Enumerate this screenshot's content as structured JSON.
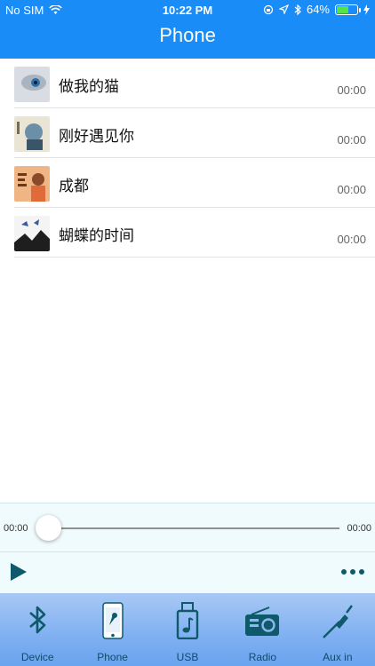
{
  "status_bar": {
    "carrier": "No SIM",
    "time": "10:22 PM",
    "battery": "64%",
    "battery_level": 0.64
  },
  "header": {
    "title": "Phone"
  },
  "songs": [
    {
      "name": "做我的猫",
      "duration": "00:00"
    },
    {
      "name": "刚好遇见你",
      "duration": "00:00"
    },
    {
      "name": "成都",
      "duration": "00:00"
    },
    {
      "name": "蝴蝶的时间",
      "duration": "00:00"
    }
  ],
  "player": {
    "elapsed": "00:00",
    "total": "00:00",
    "progress": 0
  },
  "tabs": [
    {
      "label": "Device",
      "icon": "bluetooth-icon"
    },
    {
      "label": "Phone",
      "icon": "phone-icon"
    },
    {
      "label": "USB",
      "icon": "usb-icon"
    },
    {
      "label": "Radio",
      "icon": "radio-icon"
    },
    {
      "label": "Aux in",
      "icon": "aux-cable-icon"
    }
  ],
  "colors": {
    "header": "#1a8cf8",
    "icon": "#0f5a6a"
  }
}
